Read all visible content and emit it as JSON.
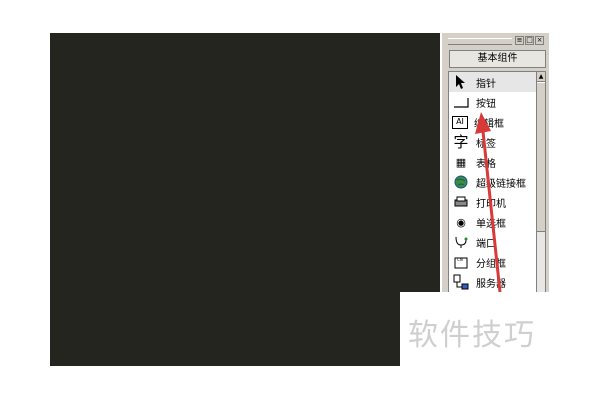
{
  "panel": {
    "title_buttons": [
      "≡",
      "□",
      "×"
    ],
    "tab_label": "基本组件",
    "items": [
      {
        "label": "指针",
        "icon": "pointer-arrow-icon",
        "glyph": "➤"
      },
      {
        "label": "按钮",
        "icon": "button-icon",
        "glyph": ""
      },
      {
        "label": "编辑框",
        "icon": "edit-box-icon",
        "glyph": "AI"
      },
      {
        "label": "标签",
        "icon": "label-icon",
        "glyph": "字"
      },
      {
        "label": "表格",
        "icon": "table-icon",
        "glyph": "▦"
      },
      {
        "label": "超级链接框",
        "icon": "hyperlink-globe-icon",
        "glyph": "🌐"
      },
      {
        "label": "打印机",
        "icon": "printer-icon",
        "glyph": "🖶"
      },
      {
        "label": "单选框",
        "icon": "radio-icon",
        "glyph": "◉"
      },
      {
        "label": "端口",
        "icon": "port-icon",
        "glyph": "⛓"
      },
      {
        "label": "分组框",
        "icon": "group-box-icon",
        "glyph": "▭"
      },
      {
        "label": "服务器",
        "icon": "server-icon",
        "glyph": "▤"
      }
    ]
  },
  "watermark": "软件技巧",
  "colors": {
    "canvas": "#25251f",
    "arrow": "#d83a3a"
  }
}
